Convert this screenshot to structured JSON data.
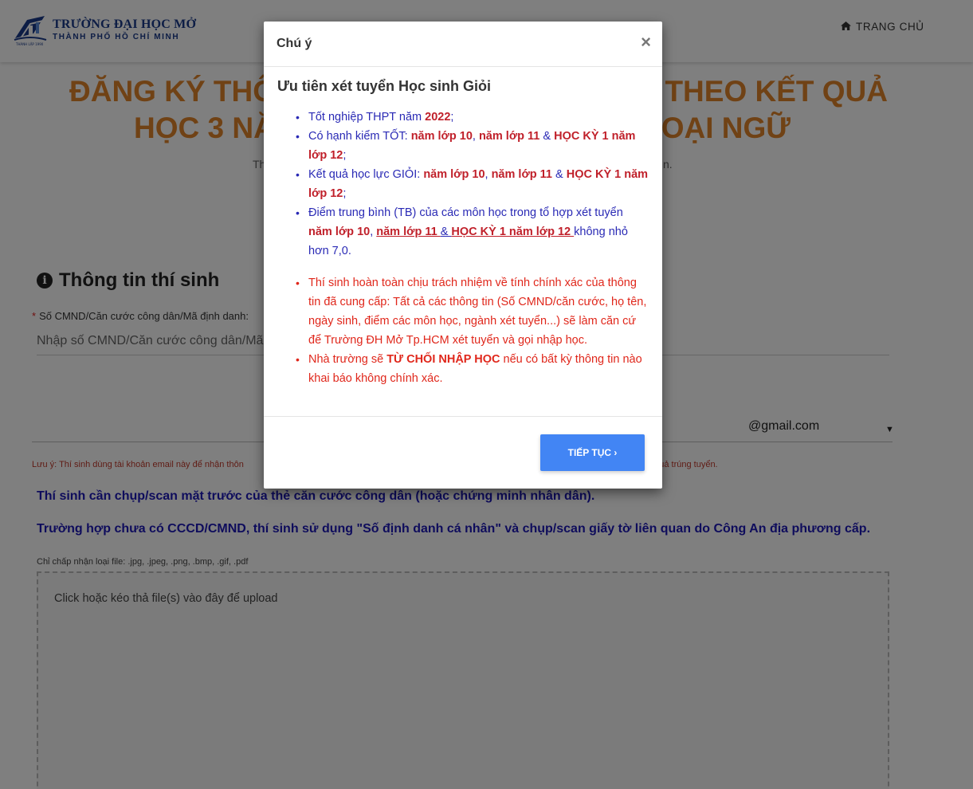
{
  "header": {
    "logo_line1": "TRƯỜNG ĐẠI HỌC MỞ",
    "logo_line2": "THÀNH PHỐ HỒ CHÍ MINH",
    "nav_home": "TRANG CHỦ"
  },
  "page": {
    "title_line1": "ĐĂNG KÝ THÔ",
    "title_line1_right": "THEO KẾT QUẢ",
    "title_line2": "HỌC 3 NĂ",
    "title_line2_right": "GOẠI NGỮ",
    "subtitle_left": "Th",
    "subtitle_right": "n.",
    "section_title": "Thông tin thí sinh",
    "id_label": "Số CMND/Căn cước công dân/Mã định danh:",
    "id_placeholder": "Nhập số CMND/Căn cước công dân/Mã",
    "email_domain": "@gmail.com",
    "note_left": "Lưu ý: Thí sinh dùng tài khoản email này để nhận thôn",
    "note_right": "t quả trúng tuyển.",
    "msg_one": "Thí sinh cần chụp/scan mặt trước của thẻ căn cước công dân (hoặc chứng minh nhân dân).",
    "msg_two": "Trường hợp chưa có CCCD/CMND, thí sinh sử dụng \"Số định danh cá nhân\" và chụp/scan giấy tờ liên quan do Công An địa phương cấp.",
    "file_types": "Chỉ chấp nhận loại file: .jpg, .jpeg, .png, .bmp, .gif, .pdf",
    "dropzone_text": "Click hoặc kéo thả file(s) vào đây để upload"
  },
  "modal": {
    "title": "Chú ý",
    "close": "×",
    "heading": "Ưu tiên xét tuyển Học sinh Giỏi",
    "i1_a": "Tốt nghiệp THPT năm ",
    "i1_b": "2022",
    "i1_c": ";",
    "i2_a": "Có hạnh kiểm TỐT: ",
    "i2_b": "năm lớp 10",
    "i2_c": ", ",
    "i2_d": "năm lớp 11",
    "i2_e": " & ",
    "i2_f": "HỌC KỲ 1 năm lớp 12",
    "i2_g": ";",
    "i3_a": "Kết quả học lực GIỎI: ",
    "i3_b": "năm lớp 10",
    "i3_c": ", ",
    "i3_d": "năm lớp 11",
    "i3_e": " & ",
    "i3_f": "HỌC KỲ 1 năm lớp 12",
    "i3_g": ";",
    "i4_a": "Điểm trung bình (TB) của các môn học trong tổ hợp xét tuyển ",
    "i4_b": "năm lớp 10",
    "i4_c": ", ",
    "i4_d": "năm lớp 11 ",
    "i4_e": "& ",
    "i4_f": "HỌC KỲ 1 năm lớp 12 ",
    "i4_g": "không nhỏ hơn 7,0.",
    "r1": "Thí sinh hoàn toàn chịu trách nhiệm về tính chính xác của thông tin đã cung cấp: Tất cả các thông tin (Số CMND/căn cước, họ tên, ngày sinh, điểm các môn học, ngành xét tuyển...) sẽ làm căn cứ để Trường ĐH Mở Tp.HCM xét tuyển và gọi nhập học.",
    "r2_a": "Nhà trường sẽ ",
    "r2_b": "TỪ CHỐI NHẬP HỌC",
    "r2_c": " nếu có bất kỳ thông tin nào khai báo không chính xác.",
    "button": "TIẾP TỤC ›"
  },
  "colors": {
    "title_orange": "#e1852b",
    "text_blue": "#2a2ab5",
    "text_red": "#e0271b",
    "button_blue": "#4285f4",
    "logo_blue": "#1a3a8a"
  },
  "icons": {
    "home": "home-icon",
    "info": "info-circle-icon",
    "close": "close-icon",
    "caret": "caret-down-icon"
  }
}
